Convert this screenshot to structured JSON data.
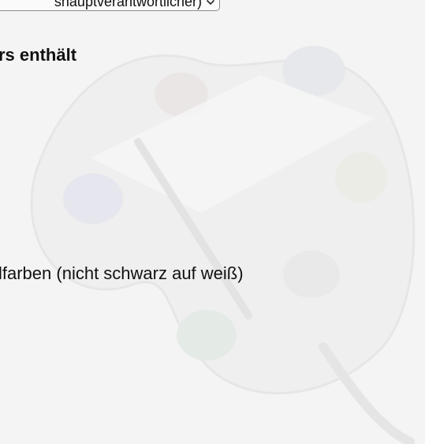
{
  "form": {
    "role_select": {
      "selected_value": "shauptverantwortlicher)"
    },
    "section_heading": "rs enthält",
    "color_option_label": "lfarben (nicht schwarz auf weiß)"
  },
  "background": {
    "illustration_icon": "painter-palette-icon"
  }
}
